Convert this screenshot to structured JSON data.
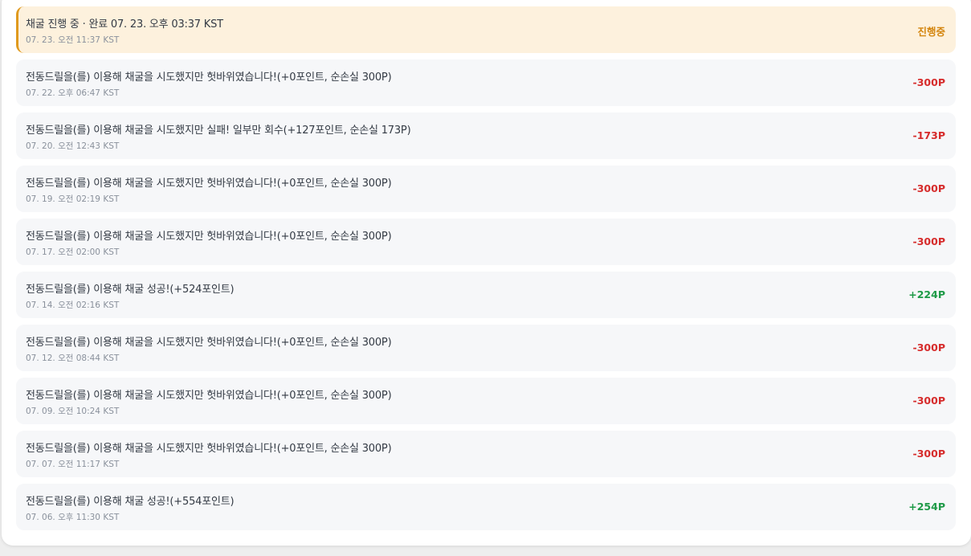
{
  "colors": {
    "negative": "#d62c2c",
    "positive": "#1e9a47",
    "pending": "#d4860f"
  },
  "entries": [
    {
      "title": "채굴 진행 중 · 완료 07. 23. 오후 03:37 KST",
      "time": "07. 23. 오전 11:37 KST",
      "amount": "진행중",
      "status": "pending"
    },
    {
      "title": "전동드릴을(를) 이용해 채굴을 시도했지만 헛바위였습니다!(+0포인트, 순손실 300P)",
      "time": "07. 22. 오후 06:47 KST",
      "amount": "-300P",
      "status": "negative"
    },
    {
      "title": "전동드릴을(를) 이용해 채굴을 시도했지만 실패! 일부만 회수(+127포인트, 순손실 173P)",
      "time": "07. 20. 오전 12:43 KST",
      "amount": "-173P",
      "status": "negative"
    },
    {
      "title": "전동드릴을(를) 이용해 채굴을 시도했지만 헛바위였습니다!(+0포인트, 순손실 300P)",
      "time": "07. 19. 오전 02:19 KST",
      "amount": "-300P",
      "status": "negative"
    },
    {
      "title": "전동드릴을(를) 이용해 채굴을 시도했지만 헛바위였습니다!(+0포인트, 순손실 300P)",
      "time": "07. 17. 오전 02:00 KST",
      "amount": "-300P",
      "status": "negative"
    },
    {
      "title": "전동드릴을(를) 이용해 채굴 성공!(+524포인트)",
      "time": "07. 14. 오전 02:16 KST",
      "amount": "+224P",
      "status": "positive"
    },
    {
      "title": "전동드릴을(를) 이용해 채굴을 시도했지만 헛바위였습니다!(+0포인트, 순손실 300P)",
      "time": "07. 12. 오전 08:44 KST",
      "amount": "-300P",
      "status": "negative"
    },
    {
      "title": "전동드릴을(를) 이용해 채굴을 시도했지만 헛바위였습니다!(+0포인트, 순손실 300P)",
      "time": "07. 09. 오전 10:24 KST",
      "amount": "-300P",
      "status": "negative"
    },
    {
      "title": "전동드릴을(를) 이용해 채굴을 시도했지만 헛바위였습니다!(+0포인트, 순손실 300P)",
      "time": "07. 07. 오전 11:17 KST",
      "amount": "-300P",
      "status": "negative"
    },
    {
      "title": "전동드릴을(를) 이용해 채굴 성공!(+554포인트)",
      "time": "07. 06. 오후 11:30 KST",
      "amount": "+254P",
      "status": "positive"
    }
  ]
}
